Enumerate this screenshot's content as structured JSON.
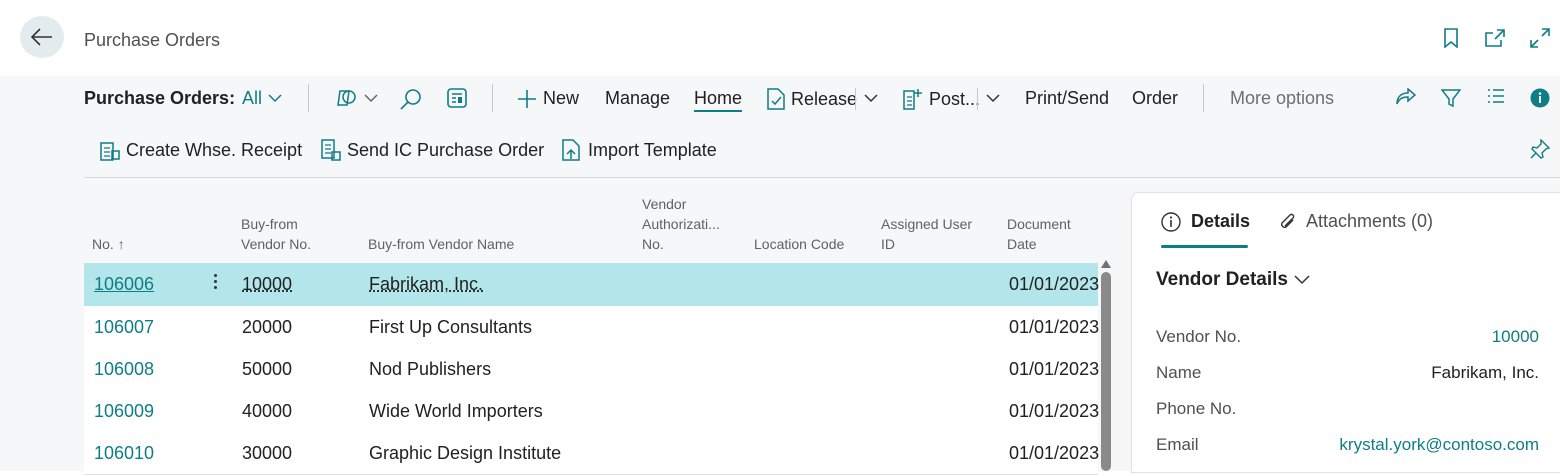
{
  "page_title": "Purchase Orders",
  "toolbar": {
    "view_label": "Purchase Orders:",
    "filter_value": "All",
    "new_label": "New",
    "manage_label": "Manage",
    "home_label": "Home",
    "release_label": "Release",
    "post_label": "Post...",
    "print_send_label": "Print/Send",
    "order_label": "Order",
    "more_options_label": "More options"
  },
  "actions": {
    "create_whse_receipt": "Create Whse. Receipt",
    "send_ic_po": "Send IC Purchase Order",
    "import_template": "Import Template"
  },
  "columns": {
    "no": "No.",
    "vendor_no_1": "Buy-from",
    "vendor_no_2": "Vendor No.",
    "vendor_name": "Buy-from Vendor Name",
    "vendor_auth_1": "Vendor",
    "vendor_auth_2": "Authorizati...",
    "vendor_auth_3": "No.",
    "location": "Location Code",
    "assigned_1": "Assigned User",
    "assigned_2": "ID",
    "docdate_1": "Document",
    "docdate_2": "Date"
  },
  "rows": [
    {
      "no": "106006",
      "vendor_no": "10000",
      "vendor_name": "Fabrikam, Inc.",
      "date": "01/01/2023"
    },
    {
      "no": "106007",
      "vendor_no": "20000",
      "vendor_name": "First Up Consultants",
      "date": "01/01/2023"
    },
    {
      "no": "106008",
      "vendor_no": "50000",
      "vendor_name": "Nod Publishers",
      "date": "01/01/2023"
    },
    {
      "no": "106009",
      "vendor_no": "40000",
      "vendor_name": "Wide World Importers",
      "date": "01/01/2023"
    },
    {
      "no": "106010",
      "vendor_no": "30000",
      "vendor_name": "Graphic Design Institute",
      "date": "01/01/2023"
    }
  ],
  "details": {
    "tab_details": "Details",
    "tab_attachments": "Attachments (0)",
    "section_title": "Vendor Details",
    "fields": {
      "vendor_no_label": "Vendor No.",
      "vendor_no_value": "10000",
      "name_label": "Name",
      "name_value": "Fabrikam, Inc.",
      "phone_label": "Phone No.",
      "phone_value": "",
      "email_label": "Email",
      "email_value": "krystal.york@contoso.com"
    }
  },
  "colors": {
    "accent": "#0f7d85",
    "selected_row": "#b3e6ea"
  }
}
